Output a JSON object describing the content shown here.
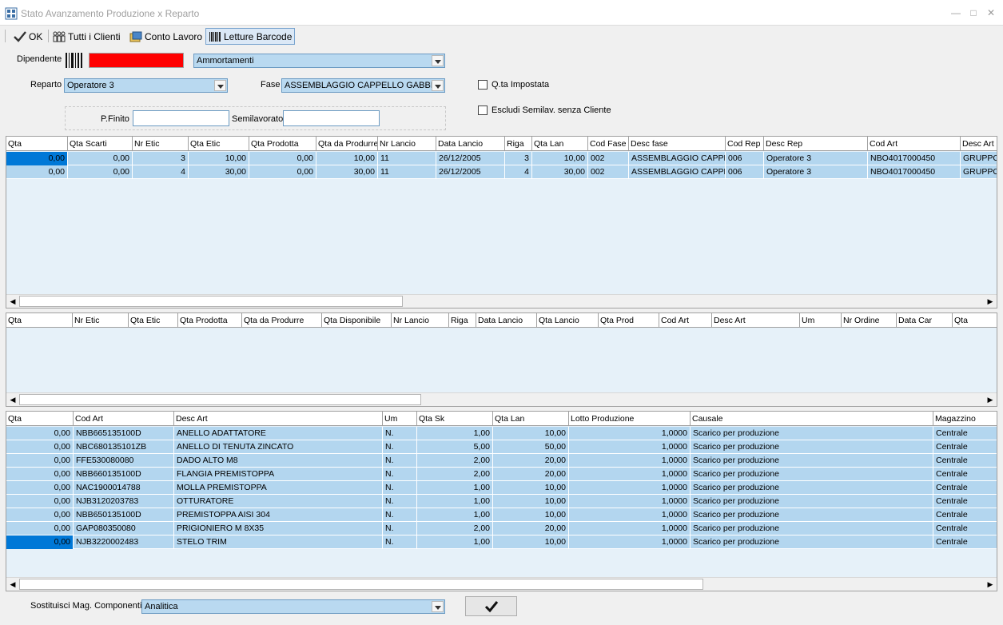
{
  "window": {
    "title": "Stato Avanzamento Produzione x Reparto"
  },
  "toolbar": {
    "ok_label": "OK",
    "clients_label": "Tutti i Clienti",
    "conto_label": "Conto Lavoro",
    "barcode_label": "Letture Barcode"
  },
  "form": {
    "dipendente_label": "Dipendente",
    "dipendente_combo": "Ammortamenti",
    "reparto_label": "Reparto",
    "reparto_value": "Operatore 3",
    "fase_label": "Fase",
    "fase_value": "ASSEMBLAGGIO CAPPELLO GABBIA",
    "qta_impostata_label": "Q.ta Impostata",
    "escludi_label": "Escludi  Semilav. senza Cliente",
    "pfinito_label": "P.Finito",
    "semilavorato_label": "Semilavorato"
  },
  "grid1": {
    "headers": [
      "Qta",
      "Qta Scarti",
      "Nr Etic",
      "Qta Etic",
      "Qta Prodotta",
      "Qta da Produrre",
      "Nr Lancio",
      "Data Lancio",
      "Riga",
      "Qta Lan",
      "Cod Fase",
      "Desc fase",
      "Cod Rep",
      "Desc Rep",
      "Cod Art",
      "Desc Art"
    ],
    "rows": [
      [
        "0,00",
        "0,00",
        "3",
        "10,00",
        "0,00",
        "10,00",
        "11",
        "26/12/2005",
        "3",
        "10,00",
        "002",
        "ASSEMBLAGGIO CAPPELLO GABBIA",
        "006",
        "Operatore 3",
        "NBO4017000450",
        "GRUPPO"
      ],
      [
        "0,00",
        "0,00",
        "4",
        "30,00",
        "0,00",
        "30,00",
        "11",
        "26/12/2005",
        "4",
        "30,00",
        "002",
        "ASSEMBLAGGIO CAPPELLO GABBIA",
        "006",
        "Operatore 3",
        "NBO4017000450",
        "GRUPPO"
      ]
    ]
  },
  "grid2": {
    "headers": [
      "Qta",
      "Nr Etic",
      "Qta Etic",
      "Qta Prodotta",
      "Qta da Produrre",
      "Qta Disponibile",
      "Nr Lancio",
      "Riga",
      "Data Lancio",
      "Qta Lancio",
      "Qta Prod",
      "Cod Art",
      "Desc Art",
      "Um",
      "Nr Ordine",
      "Data Car",
      "Qta"
    ]
  },
  "grid3": {
    "headers": [
      "Qta",
      "Cod Art",
      "Desc Art",
      "Um",
      "Qta Sk",
      "Qta Lan",
      "Lotto Produzione",
      "Causale",
      "Magazzino"
    ],
    "rows": [
      [
        "0,00",
        "NBB665135100D",
        "ANELLO ADATTATORE",
        "N.",
        "1,00",
        "10,00",
        "1,0000",
        "Scarico per produzione",
        "Centrale"
      ],
      [
        "0,00",
        "NBC680135101ZB",
        "ANELLO DI TENUTA ZINCATO",
        "N.",
        "5,00",
        "50,00",
        "1,0000",
        "Scarico per produzione",
        "Centrale"
      ],
      [
        "0,00",
        "FFE530080080",
        "DADO ALTO M8",
        "N.",
        "2,00",
        "20,00",
        "1,0000",
        "Scarico per produzione",
        "Centrale"
      ],
      [
        "0,00",
        "NBB660135100D",
        "FLANGIA PREMISTOPPA",
        "N.",
        "2,00",
        "20,00",
        "1,0000",
        "Scarico per produzione",
        "Centrale"
      ],
      [
        "0,00",
        "NAC1900014788",
        "MOLLA PREMISTOPPA",
        "N.",
        "1,00",
        "10,00",
        "1,0000",
        "Scarico per produzione",
        "Centrale"
      ],
      [
        "0,00",
        "NJB3120203783",
        "OTTURATORE",
        "N.",
        "1,00",
        "10,00",
        "1,0000",
        "Scarico per produzione",
        "Centrale"
      ],
      [
        "0,00",
        "NBB650135100D",
        "PREMISTOPPA AISI 304",
        "N.",
        "1,00",
        "10,00",
        "1,0000",
        "Scarico per produzione",
        "Centrale"
      ],
      [
        "0,00",
        "GAP080350080",
        "PRIGIONIERO M 8X35",
        "N.",
        "2,00",
        "20,00",
        "1,0000",
        "Scarico per produzione",
        "Centrale"
      ],
      [
        "0,00",
        "NJB3220002483",
        "STELO TRIM",
        "N.",
        "1,00",
        "10,00",
        "1,0000",
        "Scarico per produzione",
        "Centrale"
      ]
    ]
  },
  "bottom": {
    "sostituisci_label": "Sostituisci Mag. Componenti",
    "sostituisci_value": "Analitica"
  },
  "colors": {
    "grid_row": "#b3d6ef",
    "grid_bg": "#e6f1f9",
    "selection": "#0078d7",
    "combo": "#b9d9f0",
    "dipendente_box": "#ff0000"
  }
}
